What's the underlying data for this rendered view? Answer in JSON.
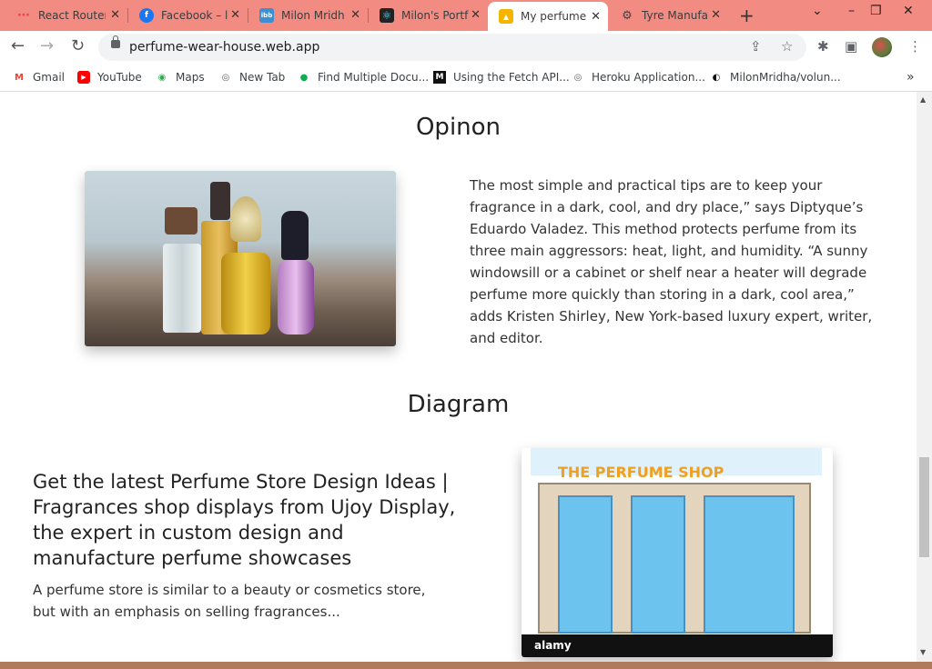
{
  "browser": {
    "tabs": [
      {
        "title": "React Router",
        "favicon_color": "#f44250",
        "favicon_glyph": "⋯",
        "active": false
      },
      {
        "title": "Facebook – l",
        "favicon_color": "#1877f2",
        "favicon_glyph": "f",
        "active": false
      },
      {
        "title": "Milon Mridh",
        "favicon_color": "#3d8fd1",
        "favicon_glyph": "ibb",
        "active": false
      },
      {
        "title": "Milon's Portf",
        "favicon_color": "#222222",
        "favicon_glyph": "⚛",
        "active": false
      },
      {
        "title": "My perfume",
        "favicon_color": "#f4b400",
        "favicon_glyph": "▲",
        "active": true
      },
      {
        "title": "Tyre Manufa",
        "favicon_color": "#444444",
        "favicon_glyph": "⚙",
        "active": false
      }
    ],
    "close_glyph": "✕",
    "new_tab_glyph": "+",
    "tab_search_glyph": "⌄",
    "window_controls": {
      "minimize": "–",
      "restore": "❐",
      "close": "✕"
    },
    "nav": {
      "back": "←",
      "forward": "→",
      "reload": "↻"
    },
    "url": "perfume-wear-house.web.app",
    "omnibox_icons": {
      "share": "⇪",
      "bookmark": "☆"
    },
    "toolbar_icons": {
      "extensions": "✱",
      "side_panel": "▣",
      "menu": "⋮"
    },
    "bookmarks": [
      {
        "label": "Gmail",
        "icon": "M",
        "color": "#ea4335"
      },
      {
        "label": "YouTube",
        "icon": "▶",
        "color": "#ff0000"
      },
      {
        "label": "Maps",
        "icon": "◉",
        "color": "#34a853"
      },
      {
        "label": "New Tab",
        "icon": "◎",
        "color": "#5f6368"
      },
      {
        "label": "Find Multiple Docu...",
        "icon": "●",
        "color": "#13aa52"
      },
      {
        "label": "Using the Fetch API...",
        "icon": "M",
        "color": "#111111"
      },
      {
        "label": "Heroku Application...",
        "icon": "◎",
        "color": "#5f6368"
      },
      {
        "label": "MilonMridha/volun...",
        "icon": "◐",
        "color": "#111111"
      }
    ],
    "bookmarks_overflow": "»"
  },
  "page": {
    "opinion_title": "Opinon",
    "opinion_text": "The most simple and practical tips are to keep your fragrance in a dark, cool, and dry place,” says Diptyque’s Eduardo Valadez. This method protects perfume from its three main aggressors: heat, light, and humidity. “A sunny windowsill or a cabinet or shelf near a heater will degrade perfume more quickly than storing in a dark, cool area,” adds Kristen Shirley, New York-based luxury expert, writer, and editor.",
    "diagram_title": "Diagram",
    "diagram_heading": "Get the latest Perfume Store Design Ideas | Fragrances shop displays from Ujoy Display, the expert in custom design and manufacture perfume showcases",
    "diagram_text": "A perfume store is similar to a beauty or cosmetics store, but with an emphasis on selling fragrances...",
    "shop_image_title": "THE PERFUME SHOP",
    "shop_image_footer": "alamy"
  }
}
